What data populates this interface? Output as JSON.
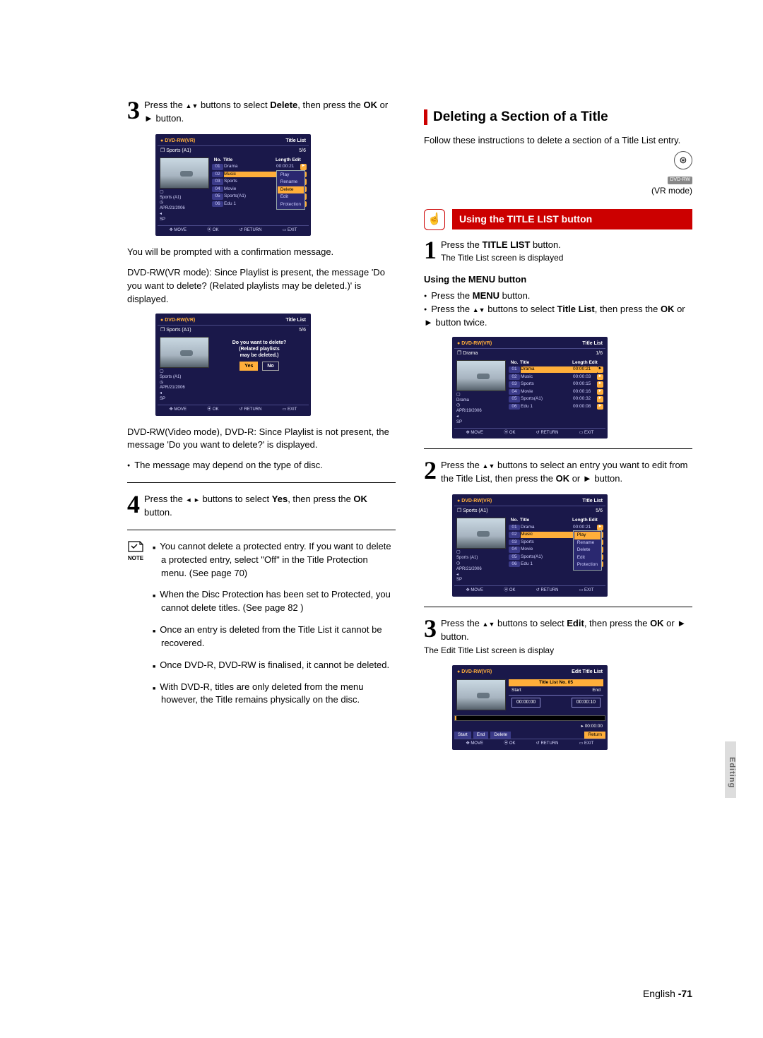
{
  "left": {
    "step3": {
      "text_a": "Press the ",
      "text_b": " buttons to select ",
      "delete": "Delete",
      "text_c": ", then press the ",
      "ok": "OK",
      "text_d": " or ",
      "play": "►",
      "text_e": " button.",
      "arrows": "▲▼"
    },
    "screen_a": {
      "mode": "DVD-RW(VR)",
      "title": "Title List",
      "clip": "Sports (A1)",
      "count": "5/6",
      "hdr": {
        "no": "No.",
        "title": "Title",
        "len": "Length Edit"
      },
      "rows": [
        {
          "n": "01",
          "t": "Drama",
          "len": "00:00:21",
          "a": "►"
        },
        {
          "n": "02",
          "t": "Music",
          "len": "",
          "hl": true
        },
        {
          "n": "03",
          "t": "Sports",
          "len": ""
        },
        {
          "n": "04",
          "t": "Movie",
          "len": ""
        },
        {
          "n": "05",
          "t": "Sports(A1)",
          "len": ""
        },
        {
          "n": "06",
          "t": "Edu 1",
          "len": ""
        }
      ],
      "ctx": [
        "Play",
        "Rename",
        "Delete",
        "Edit",
        "Protection"
      ],
      "ctx_hl": 2,
      "meta": {
        "title": "Sports (A1)",
        "date": "APR/21/2006",
        "mode": "SP"
      },
      "foot": {
        "move": "MOVE",
        "ok": "OK",
        "return": "RETURN",
        "exit": "EXIT"
      }
    },
    "confirm_para": "You will be prompted with a confirmation message.",
    "vr_para": "DVD-RW(VR mode): Since Playlist is present, the message 'Do you want to delete? (Related playlists may be deleted.)' is displayed.",
    "screen_b": {
      "mode": "DVD-RW(VR)",
      "title": "Title List",
      "clip": "Sports (A1)",
      "count": "5/6",
      "meta": {
        "title": "Sports (A1)",
        "date": "APR/21/2006",
        "mode": "SP"
      },
      "prompt1": "Do you want to delete?",
      "prompt2": "(Related playlists",
      "prompt3": "may be deleted.)",
      "yes": "Yes",
      "no": "No",
      "foot": {
        "move": "MOVE",
        "ok": "OK",
        "return": "RETURN",
        "exit": "EXIT"
      }
    },
    "video_para": "DVD-RW(Video mode), DVD-R: Since Playlist is not present, the message 'Do you want to delete?' is displayed.",
    "bullet1": "The message may depend on the type of disc.",
    "step4": {
      "text_a": "Press the ",
      "arrows": "◄ ►",
      "text_b": " buttons to select ",
      "yes": "Yes",
      "text_c": ", then press the ",
      "ok": "OK",
      "text_d": " button."
    },
    "note_label": "NOTE",
    "notes": [
      "You cannot delete a protected entry.\nIf you want to delete a protected entry, select \"Off\" in the Title Protection menu. (See page 70)",
      "When the Disc Protection has been set to Protected, you cannot delete titles. (See page 82 )",
      "Once an entry is deleted from the Title List it cannot be recovered.",
      "Once DVD-R, DVD-RW is finalised, it cannot be deleted.",
      "With DVD-R, titles are only deleted from the menu however, the Title remains physically on the disc."
    ]
  },
  "right": {
    "heading": "Deleting a Section of a Title",
    "intro": "Follow these instructions to delete a section of a Title List entry.",
    "disc_label": "DVD-RW",
    "vr": "(VR mode)",
    "subhead": "Using the TITLE LIST button",
    "hand": "☝",
    "step1": {
      "a": "Press the ",
      "b": "TITLE LIST",
      "c": " button.",
      "sub": "The Title List screen is displayed"
    },
    "menuhead": "Using the MENU button",
    "menu_b1a": "Press the ",
    "menu_b1b": "MENU",
    "menu_b1c": " button.",
    "menu_b2a": "Press the ",
    "menu_b2arr": "▲▼",
    "menu_b2b": " buttons to select ",
    "menu_b2c": "Title List",
    "menu_b2d": ", then press the ",
    "menu_b2ok": "OK",
    "menu_b2e": " or ",
    "menu_b2play": "►",
    "menu_b2f": " button twice.",
    "screen_c": {
      "mode": "DVD-RW(VR)",
      "title": "Title List",
      "clip": "Drama",
      "count": "1/6",
      "hdr": {
        "no": "No.",
        "title": "Title",
        "len": "Length Edit"
      },
      "rows": [
        {
          "n": "01",
          "t": "Drama",
          "len": "00:00:21",
          "a": "►",
          "hl": true
        },
        {
          "n": "02",
          "t": "Music",
          "len": "00:00:03",
          "a": "►"
        },
        {
          "n": "03",
          "t": "Sports",
          "len": "00:00:15",
          "a": "►"
        },
        {
          "n": "04",
          "t": "Movie",
          "len": "00:00:16",
          "a": "►"
        },
        {
          "n": "05",
          "t": "Sports(A1)",
          "len": "00:00:32",
          "a": "►"
        },
        {
          "n": "06",
          "t": "Edu 1",
          "len": "00:00:08",
          "a": "►"
        }
      ],
      "meta": {
        "title": "Drama",
        "date": "APR/19/2006",
        "mode": "SP"
      },
      "foot": {
        "move": "MOVE",
        "ok": "OK",
        "return": "RETURN",
        "exit": "EXIT"
      }
    },
    "step2": {
      "a": "Press the ",
      "arr": "▲▼",
      "b": " buttons to select an entry you want to edit from the Title List, then press the ",
      "ok": "OK",
      "c": " or ",
      "play": "►",
      "d": " button."
    },
    "screen_d": {
      "mode": "DVD-RW(VR)",
      "title": "Title List",
      "clip": "Sports (A1)",
      "count": "5/6",
      "hdr": {
        "no": "No.",
        "title": "Title",
        "len": "Length Edit"
      },
      "rows": [
        {
          "n": "01",
          "t": "Drama",
          "len": "00:00:21",
          "a": "►"
        },
        {
          "n": "02",
          "t": "Music",
          "len": "",
          "hl": true
        },
        {
          "n": "03",
          "t": "Sports",
          "len": ""
        },
        {
          "n": "04",
          "t": "Movie",
          "len": ""
        },
        {
          "n": "05",
          "t": "Sports(A1)",
          "len": ""
        },
        {
          "n": "06",
          "t": "Edu 1",
          "len": ""
        }
      ],
      "ctx": [
        "Play",
        "Rename",
        "Delete",
        "Edit",
        "Protection"
      ],
      "ctx_hl": 0,
      "meta": {
        "title": "Sports (A1)",
        "date": "APR/21/2006",
        "mode": "SP"
      },
      "foot": {
        "move": "MOVE",
        "ok": "OK",
        "return": "RETURN",
        "exit": "EXIT"
      }
    },
    "step3": {
      "a": "Press the ",
      "arr": "▲▼",
      "b": " buttons to select ",
      "edit": "Edit",
      "c": ", then press the ",
      "ok": "OK",
      "d": " or ",
      "play": "►",
      "e": " button.",
      "sub": "The Edit Title List screen is display"
    },
    "screen_e": {
      "mode": "DVD-RW(VR)",
      "title": "Edit Title List",
      "banner": "Title List No. 05",
      "start": "Start",
      "end": "End",
      "t_start": "00:00:00",
      "t_end": "00:00:10",
      "dur": "00:00:00",
      "btns": {
        "start": "Start",
        "end": "End",
        "delete": "Delete",
        "return": "Return"
      },
      "foot": {
        "move": "MOVE",
        "ok": "OK",
        "return": "RETURN",
        "exit": "EXIT"
      }
    }
  },
  "footer": {
    "lang": "English",
    "page": "-71"
  },
  "sidetab": "Editing"
}
